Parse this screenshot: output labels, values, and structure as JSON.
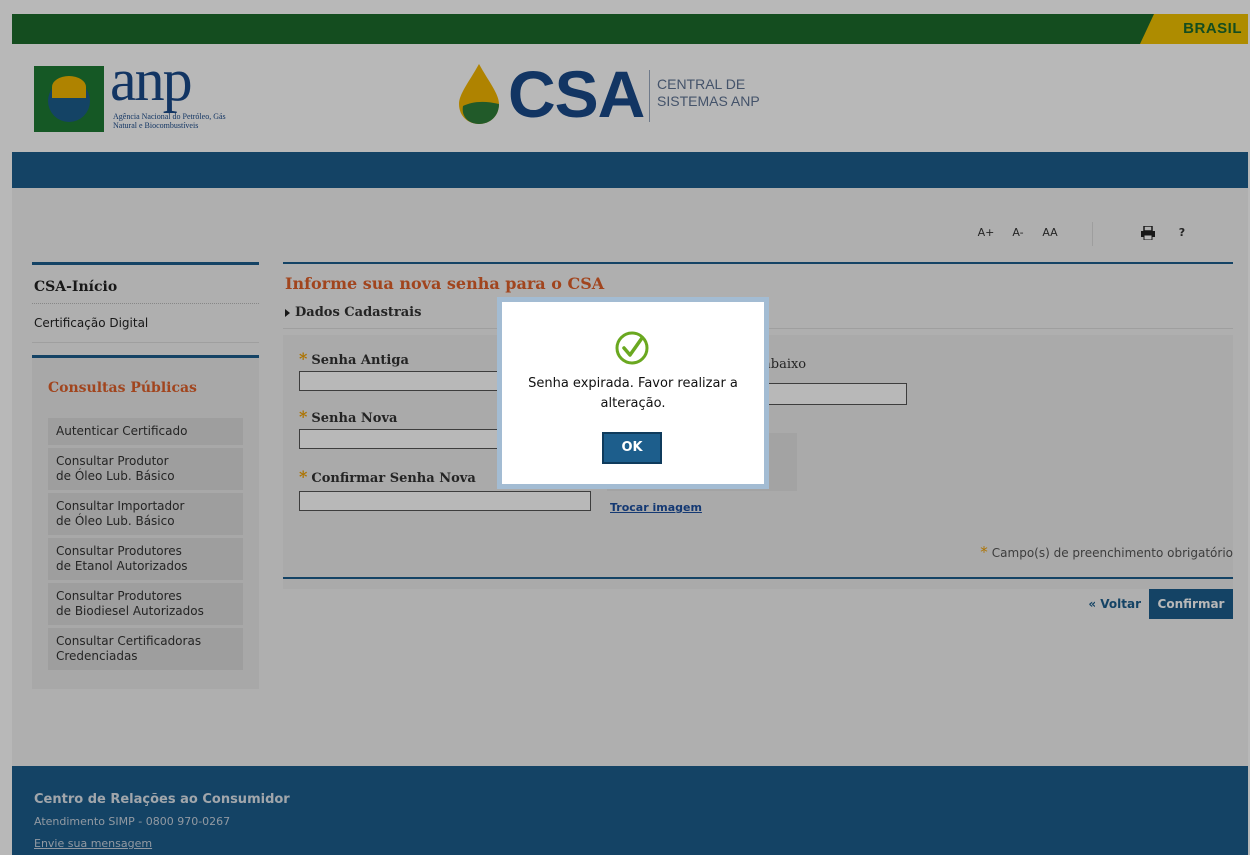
{
  "gov_bar": {
    "brasil_label": "BRASIL"
  },
  "header": {
    "anp_word": "anp",
    "anp_subtitle": "Agência Nacional do Petróleo, Gás Natural e Biocombustíveis",
    "csa_word": "CSA",
    "csa_subtitle_line1": "CENTRAL DE",
    "csa_subtitle_line2": "SISTEMAS ANP"
  },
  "toolbar": {
    "font_increase": "A+",
    "font_decrease": "A-",
    "contrast": "AA",
    "help": "?",
    "print_icon": "printer-icon"
  },
  "sidebar": {
    "home_title": "CSA-Início",
    "cert_link": "Certificação Digital",
    "section_title": "Consultas Públicas",
    "items": [
      {
        "line1": "Autenticar Certificado",
        "line2": ""
      },
      {
        "line1": "Consultar Produtor",
        "line2": "de Óleo Lub. Básico"
      },
      {
        "line1": "Consultar Importador",
        "line2": "de Óleo Lub. Básico"
      },
      {
        "line1": "Consultar Produtores",
        "line2": "de Etanol Autorizados"
      },
      {
        "line1": "Consultar Produtores",
        "line2": "de Biodiesel Autorizados"
      },
      {
        "line1": "Consultar Certificadoras",
        "line2": "Credenciadas"
      }
    ]
  },
  "main": {
    "title": "Informe sua nova senha para o CSA",
    "section": "Dados Cadastrais",
    "fields": {
      "old_password": "Senha Antiga",
      "new_password": "Senha Nova",
      "confirm_password": "Confirmar Senha Nova"
    },
    "captcha_label_fragment": "abaixo",
    "trocar_imagem": "Trocar imagem",
    "required_note": "Campo(s) de preenchimento obrigatório",
    "voltar": "« Voltar",
    "confirmar": "Confirmar"
  },
  "footer": {
    "title": "Centro de Relações ao Consumidor",
    "line": "Atendimento SIMP - 0800 970-0267",
    "link": "Envie sua mensagem"
  },
  "dialog": {
    "icon": "check-circle-icon",
    "message": "Senha expirada. Favor realizar a alteração.",
    "ok": "OK"
  },
  "colors": {
    "brand_blue": "#1d5e8c",
    "accent_orange": "#e0602a",
    "gov_green": "#1d6b2b",
    "gov_yellow": "#f2c300",
    "check_green": "#6aa820"
  }
}
